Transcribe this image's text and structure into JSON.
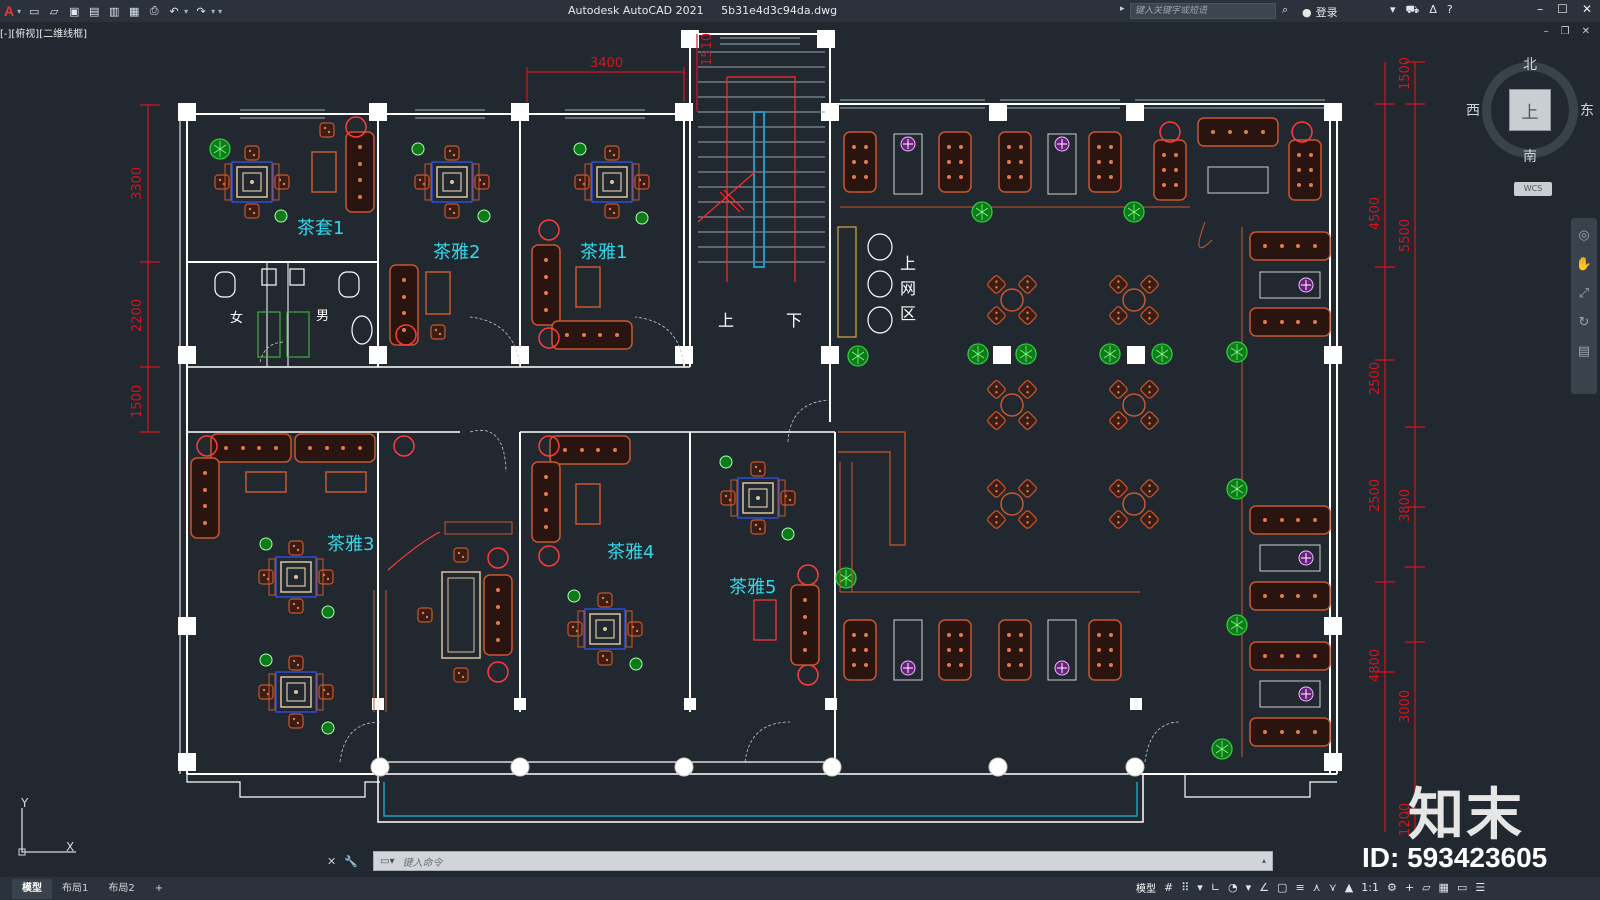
{
  "titlebar": {
    "app_logo": "A",
    "app_name": "Autodesk AutoCAD 2021",
    "file_name": "5b31e4d3c94da.dwg",
    "search_placeholder": "键入关键字或短语",
    "login_label": "登录"
  },
  "viewport": {
    "label": "[-][俯视][二维线框]"
  },
  "rooms": {
    "chatao1": "茶套1",
    "chaya2": "茶雅2",
    "chaya1": "茶雅1",
    "chaya3": "茶雅3",
    "chaya4": "茶雅4",
    "chaya5": "茶雅5",
    "wc_female": "女",
    "wc_male": "男",
    "stair_up": "上",
    "stair_down": "下",
    "internet_1": "上",
    "internet_2": "网",
    "internet_3": "区"
  },
  "dimensions": {
    "top_3400": "3400",
    "top_1510": "1510",
    "left_3300": "3300",
    "left_2200": "2200",
    "left_1500": "1500",
    "right_1500": "1500",
    "right_4500": "4500",
    "right_5500": "5500",
    "right_2500a": "2500",
    "right_2500b": "2500",
    "right_3800": "3800",
    "right_4800": "4800",
    "right_3000": "3000",
    "right_1200": "1200"
  },
  "viewcube": {
    "north": "北",
    "south": "南",
    "west": "西",
    "east": "东",
    "face": "上",
    "wcs": "WCS"
  },
  "ucs": {
    "x": "X",
    "y": "Y"
  },
  "watermark": {
    "logo": "知末",
    "id": "ID: 593423605"
  },
  "command": {
    "placeholder": "键入命令"
  },
  "layout_tabs": [
    "模型",
    "布局1",
    "布局2",
    "+"
  ],
  "status": {
    "model": "模型",
    "scale": "1:1"
  }
}
